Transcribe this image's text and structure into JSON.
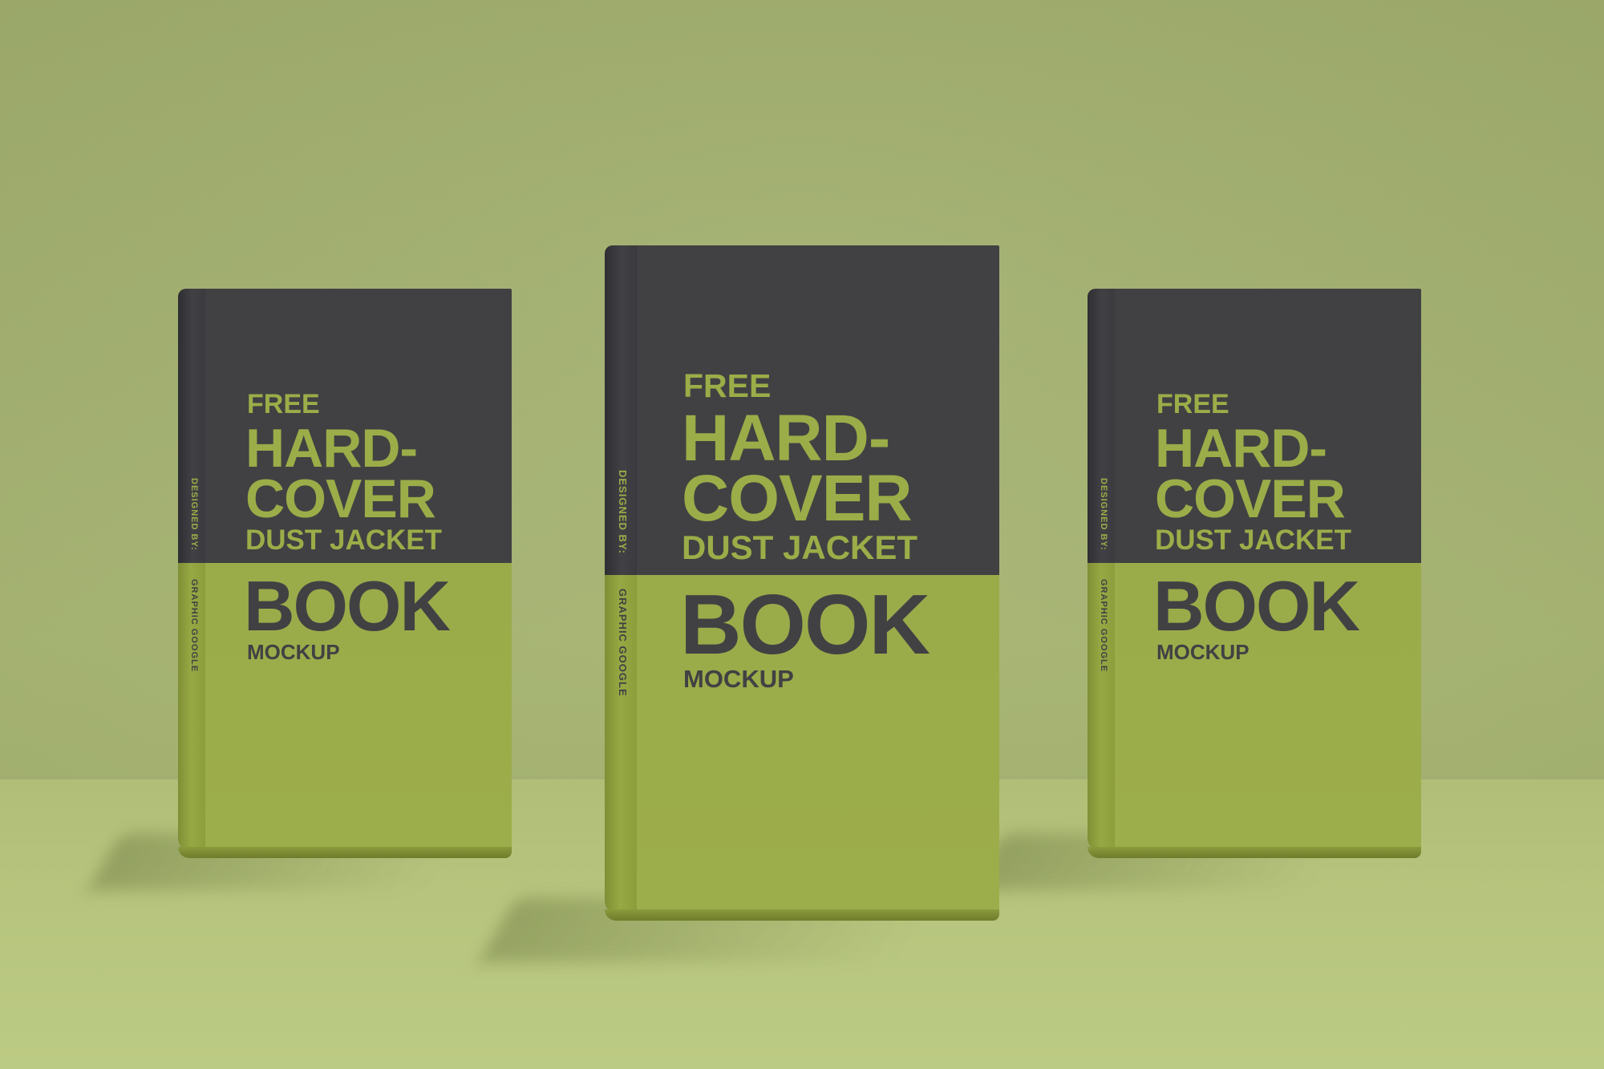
{
  "books": [
    {
      "cover_lines": [
        "FREE",
        "HARD-",
        "COVER",
        "DUST JACKET",
        "BOOK",
        "MOCKUP"
      ],
      "spine_lines": [
        "DESIGNED BY:",
        "GRAPHIC GOOGLE"
      ]
    },
    {
      "cover_lines": [
        "FREE",
        "HARD-",
        "COVER",
        "DUST JACKET",
        "BOOK",
        "MOCKUP"
      ],
      "spine_lines": [
        "DESIGNED BY:",
        "GRAPHIC GOOGLE"
      ]
    },
    {
      "cover_lines": [
        "FREE",
        "HARD-",
        "COVER",
        "DUST JACKET",
        "BOOK",
        "MOCKUP"
      ],
      "spine_lines": [
        "DESIGNED BY:",
        "GRAPHIC GOOGLE"
      ]
    }
  ],
  "colors": {
    "background": "#a7b571",
    "cover_dark": "#414143",
    "cover_green": "#9bac48"
  }
}
